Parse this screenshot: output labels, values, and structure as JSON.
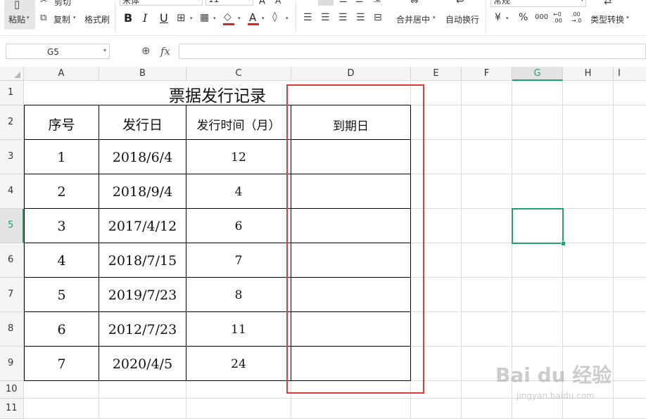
{
  "toolbar": {
    "paste_label": "粘贴",
    "cut_label": "剪切",
    "copy_label": "复制",
    "format_painter_label": "格式刷",
    "font_name": "宋体",
    "font_size": "11",
    "bold_label": "B",
    "italic_label": "I",
    "underline_label": "U",
    "merge_center_label": "合并居中",
    "wrap_text_label": "自动换行",
    "number_format": "常规",
    "currency_symbol": "¥",
    "percent_symbol": "%",
    "thousands_symbol": "000",
    "type_convert_label": "类型转换",
    "font_color": "#e02020",
    "fill_color": "#e02020"
  },
  "formula_bar": {
    "cell_ref": "G5",
    "fx_label": "fx",
    "content": ""
  },
  "columns": [
    "A",
    "B",
    "C",
    "D",
    "E",
    "F",
    "G",
    "H",
    "I"
  ],
  "rows": [
    "1",
    "2",
    "3",
    "4",
    "5",
    "6",
    "7",
    "8",
    "9",
    "10",
    "11"
  ],
  "sheet": {
    "title": "票据发行记录",
    "headers": [
      "序号",
      "发行日",
      "发行时间（月）",
      "到期日"
    ],
    "records": [
      {
        "no": "1",
        "date": "2018/6/4",
        "months": "12",
        "due": ""
      },
      {
        "no": "2",
        "date": "2018/9/4",
        "months": "4",
        "due": ""
      },
      {
        "no": "3",
        "date": "2017/4/12",
        "months": "6",
        "due": ""
      },
      {
        "no": "4",
        "date": "2018/7/15",
        "months": "7",
        "due": ""
      },
      {
        "no": "5",
        "date": "2019/7/23",
        "months": "8",
        "due": ""
      },
      {
        "no": "6",
        "date": "2012/7/23",
        "months": "11",
        "due": ""
      },
      {
        "no": "7",
        "date": "2020/4/5",
        "months": "24",
        "due": ""
      }
    ]
  },
  "selection": {
    "cell": "G5",
    "color": "#21a366"
  },
  "annotation": {
    "color": "#e53935"
  },
  "watermark": {
    "brand": "Bai du 经验",
    "url": "jingyan.baidu.com"
  }
}
